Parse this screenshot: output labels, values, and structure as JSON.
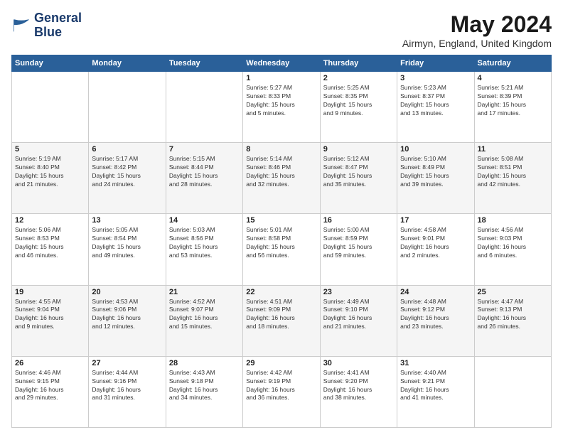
{
  "header": {
    "logo_line1": "General",
    "logo_line2": "Blue",
    "month": "May 2024",
    "location": "Airmyn, England, United Kingdom"
  },
  "weekdays": [
    "Sunday",
    "Monday",
    "Tuesday",
    "Wednesday",
    "Thursday",
    "Friday",
    "Saturday"
  ],
  "weeks": [
    [
      {
        "day": "",
        "info": ""
      },
      {
        "day": "",
        "info": ""
      },
      {
        "day": "",
        "info": ""
      },
      {
        "day": "1",
        "info": "Sunrise: 5:27 AM\nSunset: 8:33 PM\nDaylight: 15 hours\nand 5 minutes."
      },
      {
        "day": "2",
        "info": "Sunrise: 5:25 AM\nSunset: 8:35 PM\nDaylight: 15 hours\nand 9 minutes."
      },
      {
        "day": "3",
        "info": "Sunrise: 5:23 AM\nSunset: 8:37 PM\nDaylight: 15 hours\nand 13 minutes."
      },
      {
        "day": "4",
        "info": "Sunrise: 5:21 AM\nSunset: 8:39 PM\nDaylight: 15 hours\nand 17 minutes."
      }
    ],
    [
      {
        "day": "5",
        "info": "Sunrise: 5:19 AM\nSunset: 8:40 PM\nDaylight: 15 hours\nand 21 minutes."
      },
      {
        "day": "6",
        "info": "Sunrise: 5:17 AM\nSunset: 8:42 PM\nDaylight: 15 hours\nand 24 minutes."
      },
      {
        "day": "7",
        "info": "Sunrise: 5:15 AM\nSunset: 8:44 PM\nDaylight: 15 hours\nand 28 minutes."
      },
      {
        "day": "8",
        "info": "Sunrise: 5:14 AM\nSunset: 8:46 PM\nDaylight: 15 hours\nand 32 minutes."
      },
      {
        "day": "9",
        "info": "Sunrise: 5:12 AM\nSunset: 8:47 PM\nDaylight: 15 hours\nand 35 minutes."
      },
      {
        "day": "10",
        "info": "Sunrise: 5:10 AM\nSunset: 8:49 PM\nDaylight: 15 hours\nand 39 minutes."
      },
      {
        "day": "11",
        "info": "Sunrise: 5:08 AM\nSunset: 8:51 PM\nDaylight: 15 hours\nand 42 minutes."
      }
    ],
    [
      {
        "day": "12",
        "info": "Sunrise: 5:06 AM\nSunset: 8:53 PM\nDaylight: 15 hours\nand 46 minutes."
      },
      {
        "day": "13",
        "info": "Sunrise: 5:05 AM\nSunset: 8:54 PM\nDaylight: 15 hours\nand 49 minutes."
      },
      {
        "day": "14",
        "info": "Sunrise: 5:03 AM\nSunset: 8:56 PM\nDaylight: 15 hours\nand 53 minutes."
      },
      {
        "day": "15",
        "info": "Sunrise: 5:01 AM\nSunset: 8:58 PM\nDaylight: 15 hours\nand 56 minutes."
      },
      {
        "day": "16",
        "info": "Sunrise: 5:00 AM\nSunset: 8:59 PM\nDaylight: 15 hours\nand 59 minutes."
      },
      {
        "day": "17",
        "info": "Sunrise: 4:58 AM\nSunset: 9:01 PM\nDaylight: 16 hours\nand 2 minutes."
      },
      {
        "day": "18",
        "info": "Sunrise: 4:56 AM\nSunset: 9:03 PM\nDaylight: 16 hours\nand 6 minutes."
      }
    ],
    [
      {
        "day": "19",
        "info": "Sunrise: 4:55 AM\nSunset: 9:04 PM\nDaylight: 16 hours\nand 9 minutes."
      },
      {
        "day": "20",
        "info": "Sunrise: 4:53 AM\nSunset: 9:06 PM\nDaylight: 16 hours\nand 12 minutes."
      },
      {
        "day": "21",
        "info": "Sunrise: 4:52 AM\nSunset: 9:07 PM\nDaylight: 16 hours\nand 15 minutes."
      },
      {
        "day": "22",
        "info": "Sunrise: 4:51 AM\nSunset: 9:09 PM\nDaylight: 16 hours\nand 18 minutes."
      },
      {
        "day": "23",
        "info": "Sunrise: 4:49 AM\nSunset: 9:10 PM\nDaylight: 16 hours\nand 21 minutes."
      },
      {
        "day": "24",
        "info": "Sunrise: 4:48 AM\nSunset: 9:12 PM\nDaylight: 16 hours\nand 23 minutes."
      },
      {
        "day": "25",
        "info": "Sunrise: 4:47 AM\nSunset: 9:13 PM\nDaylight: 16 hours\nand 26 minutes."
      }
    ],
    [
      {
        "day": "26",
        "info": "Sunrise: 4:46 AM\nSunset: 9:15 PM\nDaylight: 16 hours\nand 29 minutes."
      },
      {
        "day": "27",
        "info": "Sunrise: 4:44 AM\nSunset: 9:16 PM\nDaylight: 16 hours\nand 31 minutes."
      },
      {
        "day": "28",
        "info": "Sunrise: 4:43 AM\nSunset: 9:18 PM\nDaylight: 16 hours\nand 34 minutes."
      },
      {
        "day": "29",
        "info": "Sunrise: 4:42 AM\nSunset: 9:19 PM\nDaylight: 16 hours\nand 36 minutes."
      },
      {
        "day": "30",
        "info": "Sunrise: 4:41 AM\nSunset: 9:20 PM\nDaylight: 16 hours\nand 38 minutes."
      },
      {
        "day": "31",
        "info": "Sunrise: 4:40 AM\nSunset: 9:21 PM\nDaylight: 16 hours\nand 41 minutes."
      },
      {
        "day": "",
        "info": ""
      }
    ]
  ]
}
